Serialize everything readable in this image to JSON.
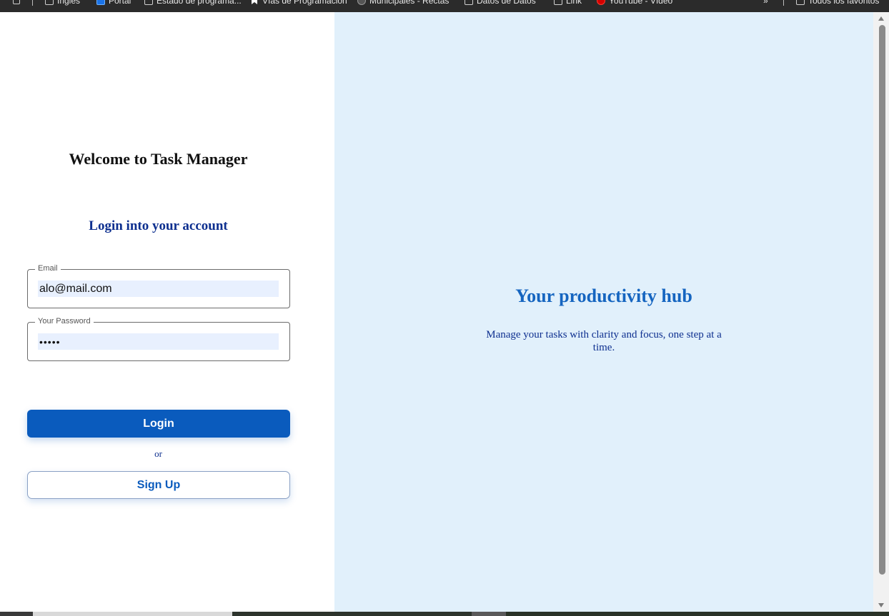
{
  "browser": {
    "bookmarks": [
      {
        "label": "Inglés",
        "icon": "folder-icon"
      },
      {
        "label": "Portal",
        "icon": "portal-icon"
      },
      {
        "label": "Estado de programa...",
        "icon": "folder-icon"
      },
      {
        "label": "Vías de Programación",
        "icon": "bookmark-icon"
      },
      {
        "label": "Municipales - Rectas",
        "icon": "globe-icon"
      },
      {
        "label": "Datos de Datos",
        "icon": "folder-icon"
      },
      {
        "label": "Link",
        "icon": "folder-icon"
      },
      {
        "label": "YouTube - Vídeo",
        "icon": "youtube-icon"
      }
    ],
    "overflow_label": "»",
    "all_bookmarks_label": "Todos los favoritos"
  },
  "login": {
    "welcome_title": "Welcome to Task Manager",
    "subtitle": "Login into your account",
    "email": {
      "legend": "Email",
      "value": "alo@mail.com"
    },
    "password": {
      "legend": "Your Password",
      "value": "•••••"
    },
    "login_label": "Login",
    "or_label": "or",
    "signup_label": "Sign Up"
  },
  "hero": {
    "title": "Your productivity hub",
    "text": "Manage your tasks with clarity and focus, one step at a time."
  },
  "colors": {
    "primary": "#0a5bbd",
    "hero_background": "#e1f0fb",
    "heading_blue": "#1565c0",
    "text_navy": "#0d2f8f"
  }
}
